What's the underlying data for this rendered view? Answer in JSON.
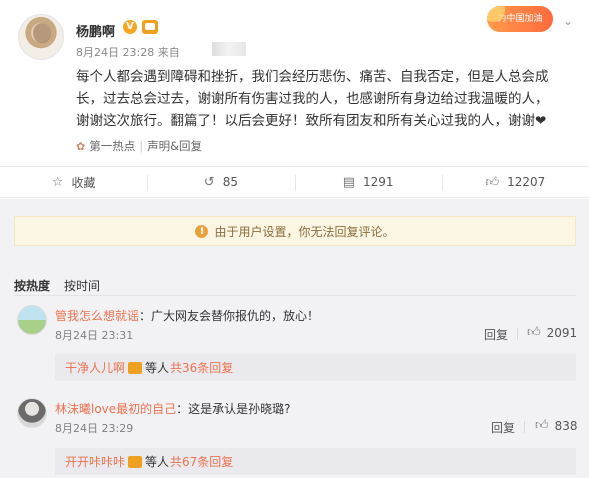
{
  "post": {
    "username": "杨鹏啊",
    "verified_badge": "V",
    "time": "8月24日 23:28 来自",
    "banner": "为中国加油",
    "text_lines": [
      "每个人都会遇到障碍和挫折，我们会经历悲伤、痛苦、自我否定，但是人总会成",
      "长，过去总会过去，谢谢所有伤害过我的人，也感谢所有身边给过我温暖的人，",
      "谢谢这次旅行。翻篇了！以后会更好！致所有团友和所有关心过我的人，谢谢❤"
    ],
    "source_label": "第一热点",
    "statement_label": "声明&回复"
  },
  "actions": {
    "favorite": "收藏",
    "forward_count": "85",
    "comment_count": "1291",
    "like_count": "12207"
  },
  "notice": {
    "text": "由于用户设置，你无法回复评论。"
  },
  "sort_tabs": {
    "by_hot": "按热度",
    "by_time": "按时间"
  },
  "comments": [
    {
      "user": "管我怎么想就谣",
      "text": "：广大网友会替你报仇的，放心！",
      "time": "8月24日 23:31",
      "reply_label": "回复",
      "likes": "2091",
      "sub_reply": {
        "nick": "干净人儿啊",
        "etc": "等人",
        "count": "共36条回复"
      }
    },
    {
      "user": "林沫曦love最初的自己",
      "text": "：这是承认是孙晓璐?",
      "time": "8月24日 23:29",
      "reply_label": "回复",
      "likes": "838",
      "sub_reply": {
        "nick": "开开咔咔咔",
        "etc": "等人",
        "count": "共67条回复"
      }
    }
  ],
  "colors": {
    "link_orange": "#eb7350",
    "page_bg": "#f2f2f5",
    "notice_bg": "#fbf5e4"
  }
}
